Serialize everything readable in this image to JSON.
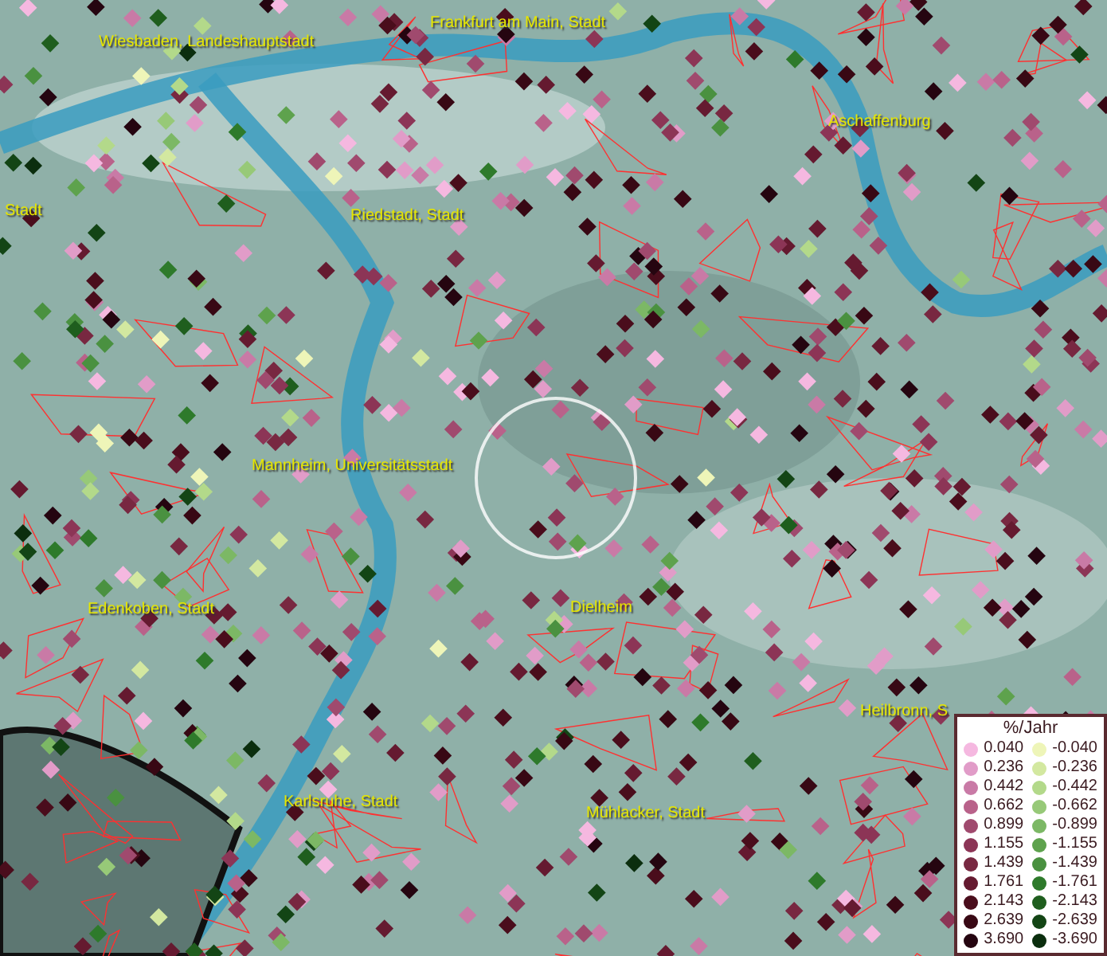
{
  "places": [
    {
      "name": "Wiesbaden, Landeshauptstadt"
    },
    {
      "name": "Frankfurt am Main, Stadt"
    },
    {
      "name": "Aschaffenburg"
    },
    {
      "name": "Stadt"
    },
    {
      "name": "Riedstadt, Stadt"
    },
    {
      "name": "Mannheim, Universitätsstadt"
    },
    {
      "name": "Edenkoben, Stadt"
    },
    {
      "name": "Dielheim"
    },
    {
      "name": "Heilbronn, S"
    },
    {
      "name": "Karlsruhe, Stadt"
    },
    {
      "name": "Mühlacker, Stadt"
    }
  ],
  "legend": {
    "title": "%/Jahr",
    "positive": [
      {
        "value": "0.040",
        "color": "#f5b8e0"
      },
      {
        "value": "0.236",
        "color": "#e19cc8"
      },
      {
        "value": "0.442",
        "color": "#c97aa6"
      },
      {
        "value": "0.662",
        "color": "#b9628a"
      },
      {
        "value": "0.899",
        "color": "#a04a6e"
      },
      {
        "value": "1.155",
        "color": "#8c3556"
      },
      {
        "value": "1.439",
        "color": "#782841"
      },
      {
        "value": "1.761",
        "color": "#651a30"
      },
      {
        "value": "2.143",
        "color": "#4a0d1c"
      },
      {
        "value": "2.639",
        "color": "#380814"
      },
      {
        "value": "3.690",
        "color": "#250510"
      }
    ],
    "negative": [
      {
        "value": "-0.040",
        "color": "#eef5b8"
      },
      {
        "value": "-0.236",
        "color": "#d3e8a0"
      },
      {
        "value": "-0.442",
        "color": "#b3d98a"
      },
      {
        "value": "-0.662",
        "color": "#97c978"
      },
      {
        "value": "-0.899",
        "color": "#7cb865"
      },
      {
        "value": "-1.155",
        "color": "#5ea24d"
      },
      {
        "value": "-1.439",
        "color": "#4a9140"
      },
      {
        "value": "-1.761",
        "color": "#2e7a2b"
      },
      {
        "value": "-2.143",
        "color": "#1f5e1e"
      },
      {
        "value": "-2.639",
        "color": "#134515"
      },
      {
        "value": "-3.690",
        "color": "#0b2e0e"
      }
    ]
  }
}
